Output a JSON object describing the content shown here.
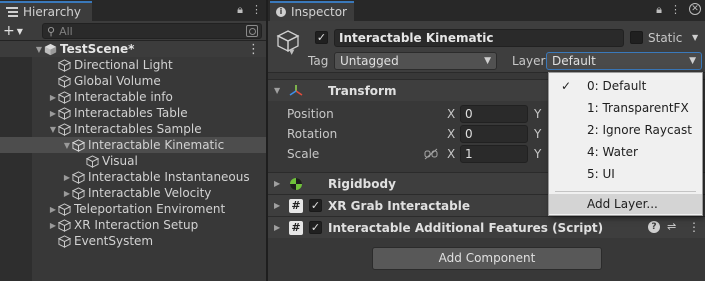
{
  "hierarchy": {
    "tab_label": "Hierarchy",
    "search_placeholder": "All",
    "scene_name": "TestScene*",
    "items": [
      {
        "label": "Directional Light"
      },
      {
        "label": "Global Volume"
      },
      {
        "label": "Interactable info"
      },
      {
        "label": "Interactables Table"
      },
      {
        "label": "Interactables Sample"
      },
      {
        "label": "Interactable Kinematic"
      },
      {
        "label": "Visual"
      },
      {
        "label": "Interactable Instantaneous"
      },
      {
        "label": "Interactable Velocity"
      },
      {
        "label": "Teleportation Enviroment"
      },
      {
        "label": "XR Interaction Setup"
      },
      {
        "label": "EventSystem"
      }
    ]
  },
  "inspector": {
    "tab_label": "Inspector",
    "object_name": "Interactable Kinematic",
    "static_label": "Static",
    "tag_label": "Tag",
    "tag_value": "Untagged",
    "layer_label": "Layer",
    "layer_value": "Default",
    "transform": {
      "title": "Transform",
      "position_label": "Position",
      "rotation_label": "Rotation",
      "scale_label": "Scale",
      "axis_x": "X",
      "axis_y": "Y",
      "position_x": "0",
      "rotation_x": "0",
      "scale_x": "1"
    },
    "components": {
      "rigidbody": "Rigidbody",
      "grab": "XR Grab Interactable",
      "additional": "Interactable Additional Features (Script)"
    },
    "add_component_label": "Add Component"
  },
  "layer_menu": {
    "items": [
      "0: Default",
      "1: TransparentFX",
      "2: Ignore Raycast",
      "4: Water",
      "5: UI"
    ],
    "selected": "0: Default",
    "add_layer": "Add Layer..."
  },
  "colors": {
    "panel_bg": "#383838",
    "selection_bg": "#4d4d4d",
    "tab_accent": "#3a79bb",
    "popup_bg": "#f0f0f0"
  }
}
